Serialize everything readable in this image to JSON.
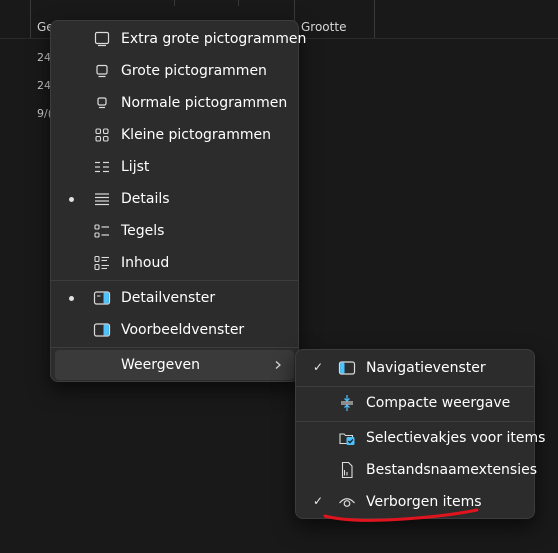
{
  "background": {
    "column_headers": [
      "Ge",
      "Grootte"
    ],
    "rows": [
      "24,",
      "24,",
      "9/("
    ]
  },
  "view_menu": {
    "items": [
      {
        "label": "Extra grote pictogrammen",
        "icon": "extra-large-icons-icon",
        "selected": false
      },
      {
        "label": "Grote pictogrammen",
        "icon": "large-icons-icon",
        "selected": false
      },
      {
        "label": "Normale pictogrammen",
        "icon": "medium-icons-icon",
        "selected": false
      },
      {
        "label": "Kleine pictogrammen",
        "icon": "small-icons-icon",
        "selected": false
      },
      {
        "label": "Lijst",
        "icon": "list-icon",
        "selected": false
      },
      {
        "label": "Details",
        "icon": "details-icon",
        "selected": true
      },
      {
        "label": "Tegels",
        "icon": "tiles-icon",
        "selected": false
      },
      {
        "label": "Inhoud",
        "icon": "content-icon",
        "selected": false
      }
    ],
    "panes": [
      {
        "label": "Detailvenster",
        "icon": "details-pane-icon",
        "selected": true
      },
      {
        "label": "Voorbeeldvenster",
        "icon": "preview-pane-icon",
        "selected": false
      }
    ],
    "show": {
      "label": "Weergeven",
      "icon": "chevron-right-icon"
    }
  },
  "show_submenu": {
    "items": [
      {
        "label": "Navigatievenster",
        "icon": "navigation-pane-icon",
        "checked": true
      },
      {
        "label": "Compacte weergave",
        "icon": "compact-view-icon",
        "checked": false
      },
      {
        "label": "Selectievakjes voor items",
        "icon": "item-checkboxes-icon",
        "checked": false
      },
      {
        "label": "Bestandsnaamextensies",
        "icon": "file-extensions-icon",
        "checked": false
      },
      {
        "label": "Verborgen items",
        "icon": "eye-icon",
        "checked": true
      }
    ]
  },
  "marks": {
    "check": "✓"
  },
  "colors": {
    "accent": "#4cc2ff",
    "annotation": "#e0141e",
    "menu_bg": "#2c2c2c"
  }
}
